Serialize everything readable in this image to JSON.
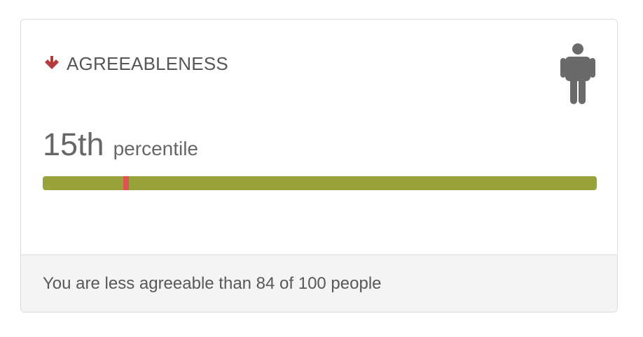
{
  "trait": {
    "direction_icon": "down-arrow-icon",
    "direction_color": "#b43b3a",
    "name": "AGREEABLENESS",
    "person_icon": "person-icon",
    "person_icon_color": "#6a6a6a"
  },
  "score": {
    "percentile_value": "15th",
    "percentile_label": "percentile",
    "marker_fraction": 0.15
  },
  "colors": {
    "bar_color": "#99a33c",
    "marker_color": "#e05353",
    "footer_bg": "#f4f4f4"
  },
  "footer": {
    "summary": "You are less agreeable than 84 of 100 people"
  }
}
